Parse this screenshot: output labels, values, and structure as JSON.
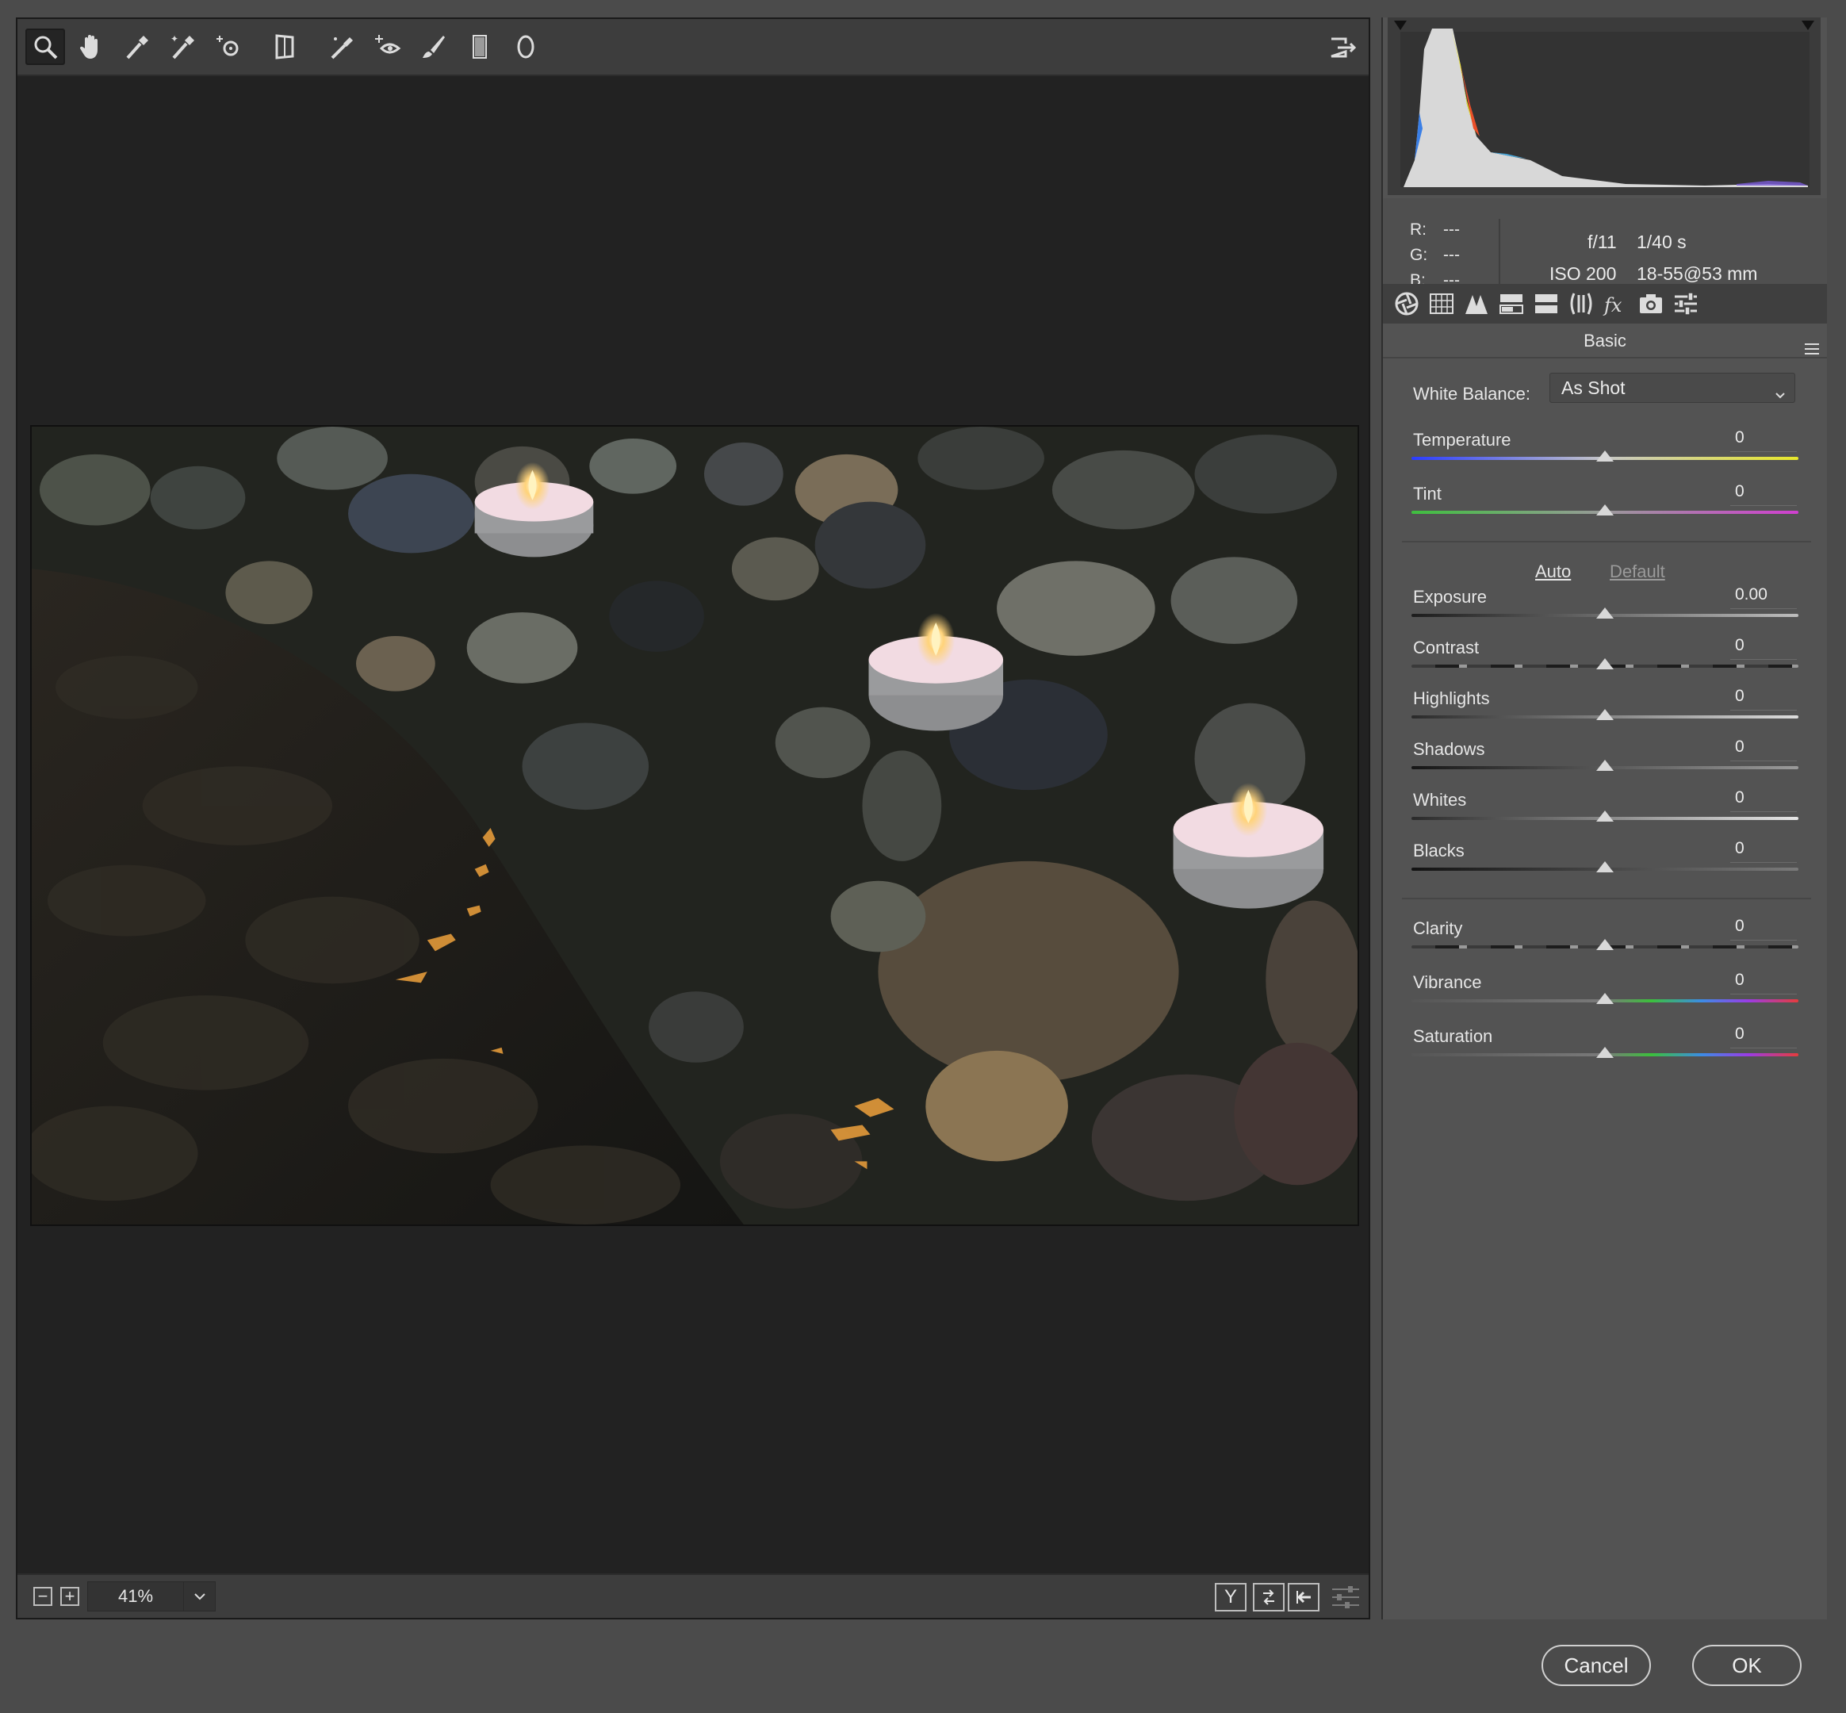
{
  "toolbar": {
    "tools": [
      "zoom-tool",
      "hand-tool",
      "white-balance-tool",
      "color-sampler-tool",
      "targeted-adjustment-tool",
      "transform-tool",
      "spot-removal-tool",
      "red-eye-tool",
      "adjustment-brush",
      "graduated-filter",
      "radial-filter"
    ],
    "open_preferences_icon": "export-icon"
  },
  "zoom": {
    "value": "41%"
  },
  "readout": {
    "r_label": "R:",
    "g_label": "G:",
    "b_label": "B:",
    "r_value": "---",
    "g_value": "---",
    "b_value": "---",
    "aperture": "f/11",
    "shutter": "1/40 s",
    "iso": "ISO 200",
    "lens": "18-55@53 mm"
  },
  "panel": {
    "title": "Basic",
    "white_balance_label": "White Balance:",
    "white_balance_value": "As Shot",
    "auto_label": "Auto",
    "default_label": "Default",
    "sliders": [
      {
        "label": "Temperature",
        "value": "0",
        "level": 0.5
      },
      {
        "label": "Tint",
        "value": "0",
        "level": 0.5
      },
      {
        "label": "Exposure",
        "value": "0.00",
        "level": 0.5
      },
      {
        "label": "Contrast",
        "value": "0",
        "level": 0.5
      },
      {
        "label": "Highlights",
        "value": "0",
        "level": 0.5
      },
      {
        "label": "Shadows",
        "value": "0",
        "level": 0.5
      },
      {
        "label": "Whites",
        "value": "0",
        "level": 0.5
      },
      {
        "label": "Blacks",
        "value": "0",
        "level": 0.5
      },
      {
        "label": "Clarity",
        "value": "0",
        "level": 0.5
      },
      {
        "label": "Vibrance",
        "value": "0",
        "level": 0.5
      },
      {
        "label": "Saturation",
        "value": "0",
        "level": 0.5
      }
    ]
  },
  "buttons": {
    "cancel": "Cancel",
    "ok": "OK"
  },
  "colors": {
    "accent_link": "#e6e6e6",
    "default_link": "#9a9a9a",
    "temperature_start": "#2a3cff",
    "temperature_end": "#e8e82a",
    "tint_start": "#3fbf3f",
    "tint_end": "#d03fd0"
  }
}
